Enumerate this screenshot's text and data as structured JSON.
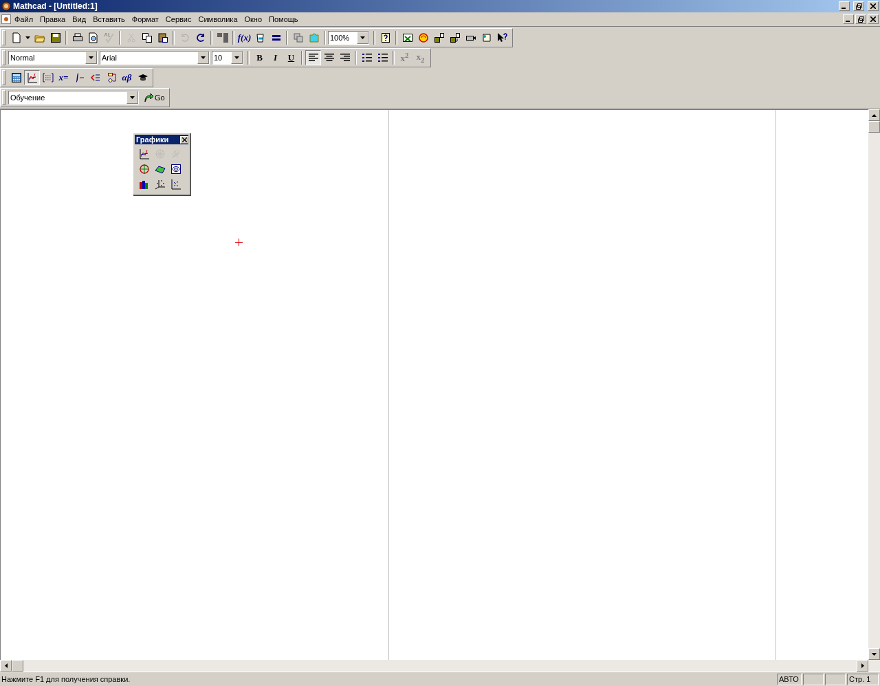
{
  "window": {
    "title": "Mathcad - [Untitled:1]"
  },
  "menu": [
    "Файл",
    "Правка",
    "Вид",
    "Вставить",
    "Формат",
    "Сервис",
    "Символика",
    "Окно",
    "Помощь"
  ],
  "standard_toolbar": {
    "buttons": [
      {
        "disabled": false
      },
      {
        "disabled": false
      },
      {
        "disabled": false
      },
      {
        "disabled": false
      },
      {
        "disabled": false
      },
      {
        "disabled": false
      },
      {
        "disabled": true
      },
      {
        "disabled": true
      },
      {
        "disabled": false
      },
      {
        "disabled": false
      },
      {
        "disabled": true
      },
      {
        "disabled": false
      },
      {
        "disabled": false
      }
    ],
    "function_label": "f(x)",
    "buttons_2": [
      {
        "disabled": false
      },
      {
        "disabled": false
      },
      {
        "disabled": false
      },
      {
        "disabled": false
      }
    ],
    "zoom": "100%",
    "buttons_3": [
      {
        "disabled": false
      },
      {
        "disabled": false
      },
      {
        "disabled": false
      },
      {
        "disabled": false
      },
      {
        "disabled": false
      },
      {
        "disabled": false
      },
      {
        "disabled": false
      },
      {
        "disabled": false
      }
    ]
  },
  "format_toolbar": {
    "style": "Normal",
    "font": "Arial",
    "size": "10",
    "text_buttons": [
      {
        "label": "B",
        "disabled": false
      },
      {
        "label": "I",
        "disabled": false
      },
      {
        "label": "U",
        "disabled": false
      }
    ],
    "align_buttons": [
      {
        "selected": true
      },
      {
        "selected": false
      },
      {
        "selected": false
      }
    ],
    "list_buttons": [
      {
        "disabled": false
      },
      {
        "disabled": false
      }
    ],
    "script_buttons": [
      {
        "label": "x$^{2}$",
        "disabled": true
      },
      {
        "label": "x$_{2}$",
        "disabled": true
      }
    ]
  },
  "math_toolbar": {
    "buttons": [
      {
        "selected": false
      },
      {
        "selected": true
      },
      {
        "selected": false
      },
      {
        "label": "x=",
        "selected": false
      },
      {
        "selected": false
      },
      {
        "selected": false
      },
      {
        "selected": false
      },
      {
        "label": "αβ",
        "selected": false
      },
      {
        "selected": false
      }
    ]
  },
  "resources_toolbar": {
    "value": "Обучение",
    "go": "Go"
  },
  "graph_palette": {
    "title": "Графики",
    "buttons": [
      {
        "disabled": false
      },
      {
        "disabled": true
      },
      {
        "disabled": true
      },
      {
        "disabled": false
      },
      {
        "disabled": false
      },
      {
        "disabled": false
      },
      {
        "disabled": false
      },
      {
        "disabled": false
      },
      {
        "disabled": false
      }
    ]
  },
  "status_bar": {
    "message": "Нажмите F1 для получения справки.",
    "mode": "АВТО",
    "page": "Стр. 1"
  }
}
